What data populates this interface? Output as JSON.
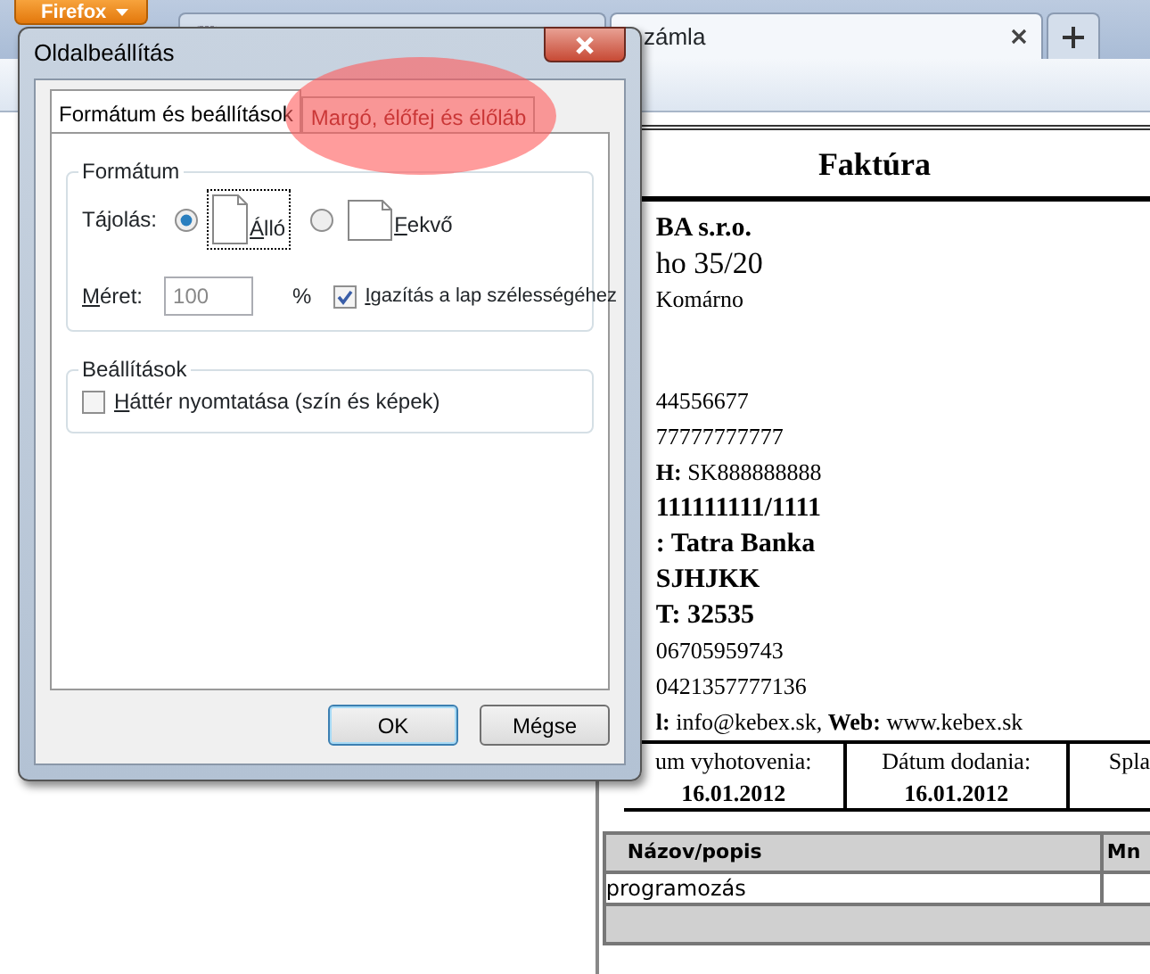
{
  "browser": {
    "menu_button": "Firefox",
    "tabs": [
      {
        "selected": false
      },
      {
        "label": "zámla",
        "selected": true
      }
    ]
  },
  "invoice": {
    "title": "Faktúra",
    "lines": [
      {
        "text": "BA s.r.o.",
        "kind": "bold"
      },
      {
        "text": "ho 35/20",
        "kind": "large"
      },
      {
        "text": "Komárno",
        "kind": "plain"
      },
      {
        "text": "44556677",
        "kind": "spaced"
      },
      {
        "text": "77777777777",
        "kind": "plain"
      },
      {
        "text": "**H:** SK888888888",
        "kind": "plain"
      },
      {
        "text": "111111111/1111",
        "kind": "bold"
      },
      {
        "text": ": Tatra Banka",
        "kind": "bold"
      },
      {
        "text": "SJHJKK",
        "kind": "bold"
      },
      {
        "text": "T: 32535",
        "kind": "bold"
      },
      {
        "text": "06705959743",
        "kind": "plain"
      },
      {
        "text": "0421357777136",
        "kind": "plain"
      },
      {
        "text": "**l:** info@kebex.sk, **Web:** www.kebex.sk",
        "kind": "plain"
      }
    ],
    "dates": [
      {
        "label": "um vyhotovenia:",
        "value": "16.01.2012"
      },
      {
        "label": "Dátum dodania:",
        "value": "16.01.2012"
      },
      {
        "label": "Spla"
      }
    ],
    "items": {
      "columns": [
        "Názov/popis",
        "Mn"
      ],
      "rows": [
        {
          "name": "programozás"
        }
      ]
    }
  },
  "dialog": {
    "title": "Oldalbeállítás",
    "tabs": [
      {
        "label": "Formátum és beállítások",
        "selected": true
      },
      {
        "label": "Margó, élőfej és élőláb",
        "selected": false
      }
    ],
    "format_group": {
      "legend": "Formátum",
      "orientation_label": "Tájolás:",
      "orientations": [
        {
          "label": "Álló",
          "kind": "portrait",
          "selected": true
        },
        {
          "label": "Fekvő",
          "kind": "landscape",
          "selected": false
        }
      ],
      "size_label": "Méret:",
      "size_value": "100",
      "size_unit": "%",
      "shrink_to_fit": {
        "label": "Igazítás a lap szélességéhez",
        "checked": true
      }
    },
    "options_group": {
      "legend": "Beállítások",
      "print_background": {
        "label": "Háttér nyomtatása (szín és képek)",
        "checked": false
      }
    },
    "buttons": [
      {
        "label": "OK",
        "default": true
      },
      {
        "label": "Mégse",
        "default": false
      }
    ]
  },
  "highlight_ellipse": true
}
